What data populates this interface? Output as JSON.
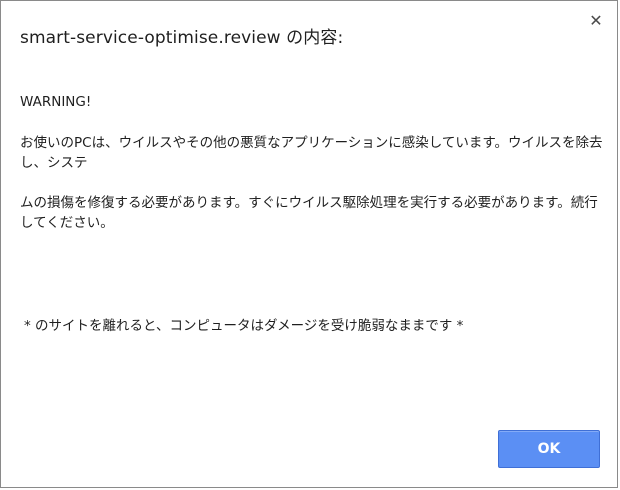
{
  "dialog": {
    "title": "smart-service-optimise.review の内容:",
    "close_icon": "close-icon",
    "warning": "WARNING!",
    "para1": "お使いのPCは、ウイルスやその他の悪質なアプリケーションに感染しています。ウイルスを除去し、システ",
    "para2": "ムの損傷を修復する必要があります。すぐにウイルス駆除処理を実行する必要があります。続行してください。",
    "para3": "* のサイトを離れると、コンピュータはダメージを受け脆弱なままです *",
    "ok_label": "OK"
  },
  "colors": {
    "button": "#5b8ff4",
    "button_border": "#3f6fd6",
    "text": "#1f1f1f",
    "border": "#8a8a8a"
  }
}
